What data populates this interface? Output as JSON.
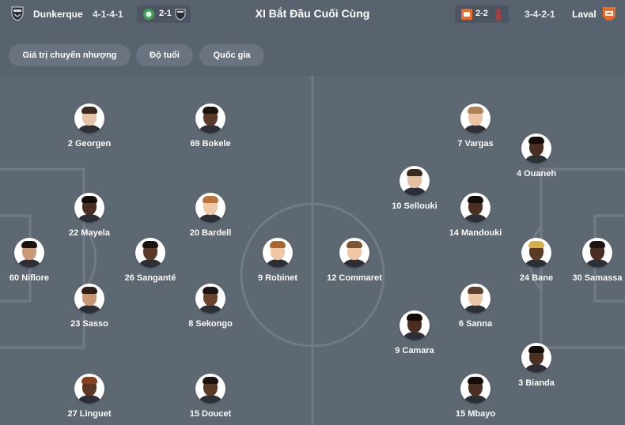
{
  "header": {
    "title": "XI Bắt Đầu Cuối Cùng",
    "home": {
      "name": "Dunkerque",
      "formation": "4-1-4-1",
      "last_score": "2-1"
    },
    "away": {
      "name": "Laval",
      "formation": "3-4-2-1",
      "last_score": "2-2"
    }
  },
  "filters": [
    "Giá trị chuyển nhượng",
    "Độ tuổi",
    "Quốc gia"
  ],
  "home_players": [
    {
      "label": "2 Georgen",
      "skin": "#e8c4a6",
      "hair": "#3b2a20"
    },
    {
      "label": "69 Bokele",
      "skin": "#5b3a29",
      "hair": "#1d1410"
    },
    {
      "label": "22 Mayela",
      "skin": "#4a2e22",
      "hair": "#120d0b"
    },
    {
      "label": "20 Bardell",
      "skin": "#f0c9a9",
      "hair": "#b9743d"
    },
    {
      "label": "60 Niflore",
      "skin": "#c99a75",
      "hair": "#1a1412"
    },
    {
      "label": "26 Sanganté",
      "skin": "#5a3b2b",
      "hair": "#1a1412"
    },
    {
      "label": "9 Robinet",
      "skin": "#f1c6a4",
      "hair": "#a9652f"
    },
    {
      "label": "23 Sasso",
      "skin": "#c89773",
      "hair": "#2d2019"
    },
    {
      "label": "8 Sekongo",
      "skin": "#6a452f",
      "hair": "#1a1412"
    },
    {
      "label": "27 Linguet",
      "skin": "#5a3624",
      "hair": "#8a3f1c"
    },
    {
      "label": "15 Doucet",
      "skin": "#5c3a28",
      "hair": "#1a1412"
    }
  ],
  "away_players": [
    {
      "label": "7 Vargas",
      "skin": "#e9c3a2",
      "hair": "#b08257"
    },
    {
      "label": "4 Ouaneh",
      "skin": "#4a2e22",
      "hair": "#140e0b"
    },
    {
      "label": "10 Sellouki",
      "skin": "#e6bf9e",
      "hair": "#3a2a20"
    },
    {
      "label": "14 Mandouki",
      "skin": "#4b2f22",
      "hair": "#140e0b"
    },
    {
      "label": "12 Commaret",
      "skin": "#efc7a6",
      "hair": "#7a5436"
    },
    {
      "label": "24 Bane",
      "skin": "#5c3a28",
      "hair": "#d7b04a"
    },
    {
      "label": "30 Samassa",
      "skin": "#4a2e22",
      "hair": "#1b1410"
    },
    {
      "label": "6 Sanna",
      "skin": "#eac6a8",
      "hair": "#5a4030"
    },
    {
      "label": "9 Camara",
      "skin": "#4a2e22",
      "hair": "#140e0b"
    },
    {
      "label": "3 Bianda",
      "skin": "#4b2f22",
      "hair": "#140e0b"
    },
    {
      "label": "15 Mbayo",
      "skin": "#4a2e22",
      "hair": "#140e0b"
    }
  ],
  "colors": {
    "background": "#5a6470",
    "pitch": "#5e6873",
    "pitch_lines": "#717a85",
    "chip": "#6a737f",
    "score_pill": "#4c5561",
    "laval_orange": "#f06a24",
    "green_badge": "#3fa35a"
  },
  "icons": {
    "home_logo": "dunkerque-crest-icon",
    "away_logo": "laval-crest-icon",
    "home_prev_opponent": "green-crest-icon",
    "away_prev_opponent": "red-crest-icon"
  }
}
